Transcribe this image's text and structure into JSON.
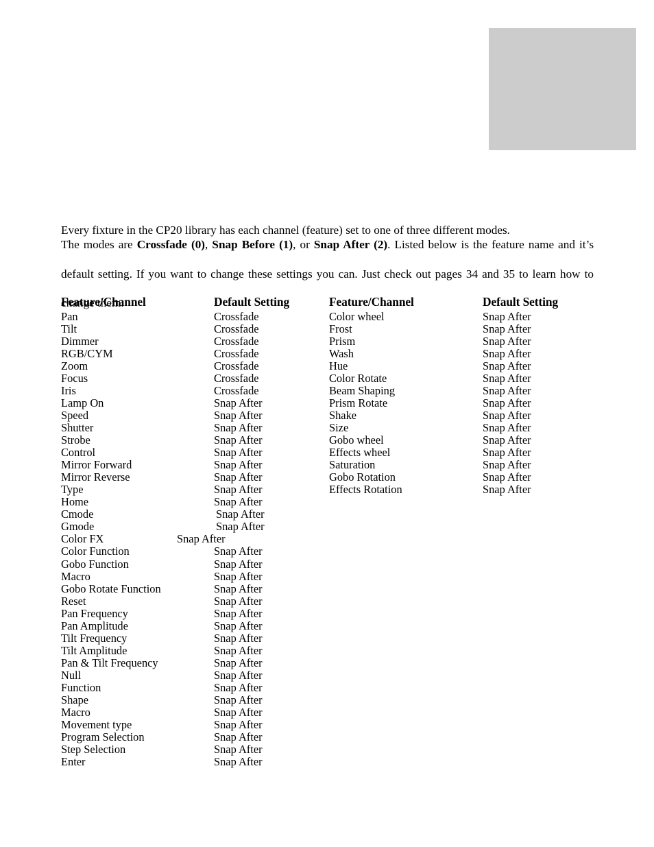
{
  "page": {
    "background_color": "#ffffff",
    "text_color": "#000000",
    "decoration": {
      "gray_block_color": "#cccccc"
    }
  },
  "intro": {
    "line1": "Every fixture in the CP20 library has each channel (feature) set to one of three different modes.",
    "line2_prefix": "The modes are ",
    "bold1": "Crossfade (0)",
    "sep1": ", ",
    "bold2": "Snap Before (1)",
    "sep2": ", or ",
    "bold3": "Snap After (2)",
    "line2_suffix": ". Listed below is the feature name and it’s",
    "line3": "default setting. If you want to change these settings you can. Just check out pages 34 and 35 to learn how to",
    "line4": "change them."
  },
  "table": {
    "headers": {
      "feature_left": "Feature/Channel",
      "setting_left": "Default Setting",
      "feature_right": "Feature/Channel",
      "setting_right": "Default Setting"
    },
    "left_rows": [
      {
        "feature": "Pan",
        "setting": "Crossfade"
      },
      {
        "feature": "Tilt",
        "setting": "Crossfade"
      },
      {
        "feature": "Dimmer",
        "setting": "Crossfade"
      },
      {
        "feature": "RGB/CYM",
        "setting": "Crossfade"
      },
      {
        "feature": "Zoom",
        "setting": "Crossfade"
      },
      {
        "feature": "Focus",
        "setting": "Crossfade"
      },
      {
        "feature": "Iris",
        "setting": "Crossfade"
      },
      {
        "feature": "Lamp On",
        "setting": "Snap After"
      },
      {
        "feature": "Speed",
        "setting": "Snap After"
      },
      {
        "feature": "Shutter",
        "setting": "Snap After"
      },
      {
        "feature": "Strobe",
        "setting": "Snap After"
      },
      {
        "feature": "Control",
        "setting": "Snap After"
      },
      {
        "feature": "Mirror Forward",
        "setting": "Snap After"
      },
      {
        "feature": "Mirror Reverse",
        "setting": "Snap After"
      },
      {
        "feature": "Type",
        "setting": "Snap After"
      },
      {
        "feature": "Home",
        "setting": "Snap After"
      },
      {
        "feature": "Cmode",
        "setting": "Snap After",
        "offset": "right"
      },
      {
        "feature": "Gmode",
        "setting": "Snap After",
        "offset": "right"
      },
      {
        "feature": "Color FX",
        "setting": "Snap After",
        "offset": "left"
      },
      {
        "feature": "Color Function",
        "setting": "Snap After"
      },
      {
        "feature": "Gobo Function",
        "setting": "Snap After"
      },
      {
        "feature": "Macro",
        "setting": "Snap After"
      },
      {
        "feature": "Gobo Rotate Function",
        "setting": "Snap After"
      },
      {
        "feature": "Reset",
        "setting": "Snap After"
      },
      {
        "feature": "Pan Frequency",
        "setting": "Snap After"
      },
      {
        "feature": "Pan Amplitude",
        "setting": "Snap After"
      },
      {
        "feature": "Tilt Frequency",
        "setting": "Snap After"
      },
      {
        "feature": "Tilt Amplitude",
        "setting": "Snap After"
      },
      {
        "feature": "Pan & Tilt Frequency",
        "setting": "Snap After"
      },
      {
        "feature": "Null",
        "setting": "Snap After"
      },
      {
        "feature": "Function",
        "setting": "Snap After"
      },
      {
        "feature": "Shape",
        "setting": "Snap After"
      },
      {
        "feature": "Macro",
        "setting": "Snap After"
      },
      {
        "feature": "Movement type",
        "setting": "Snap After"
      },
      {
        "feature": "Program Selection",
        "setting": "Snap After"
      },
      {
        "feature": "Step Selection",
        "setting": "Snap After"
      },
      {
        "feature": "Enter",
        "setting": "Snap After"
      }
    ],
    "right_rows": [
      {
        "feature": "Color  wheel",
        "setting": "Snap After"
      },
      {
        "feature": "Frost",
        "setting": "Snap After"
      },
      {
        "feature": "Prism",
        "setting": "Snap After"
      },
      {
        "feature": "Wash",
        "setting": "Snap After"
      },
      {
        "feature": "Hue",
        "setting": "Snap After"
      },
      {
        "feature": "Color Rotate",
        "setting": "Snap After"
      },
      {
        "feature": "Beam Shaping",
        "setting": "Snap After"
      },
      {
        "feature": "Prism Rotate",
        "setting": "Snap After"
      },
      {
        "feature": "Shake",
        "setting": "Snap After"
      },
      {
        "feature": "Size",
        "setting": "Snap After"
      },
      {
        "feature": "Gobo wheel",
        "setting": "Snap After"
      },
      {
        "feature": "Effects wheel",
        "setting": "Snap After"
      },
      {
        "feature": "Saturation",
        "setting": "Snap After"
      },
      {
        "feature": "Gobo Rotation",
        "setting": "Snap After"
      },
      {
        "feature": "Effects Rotation",
        "setting": "Snap After"
      }
    ]
  }
}
